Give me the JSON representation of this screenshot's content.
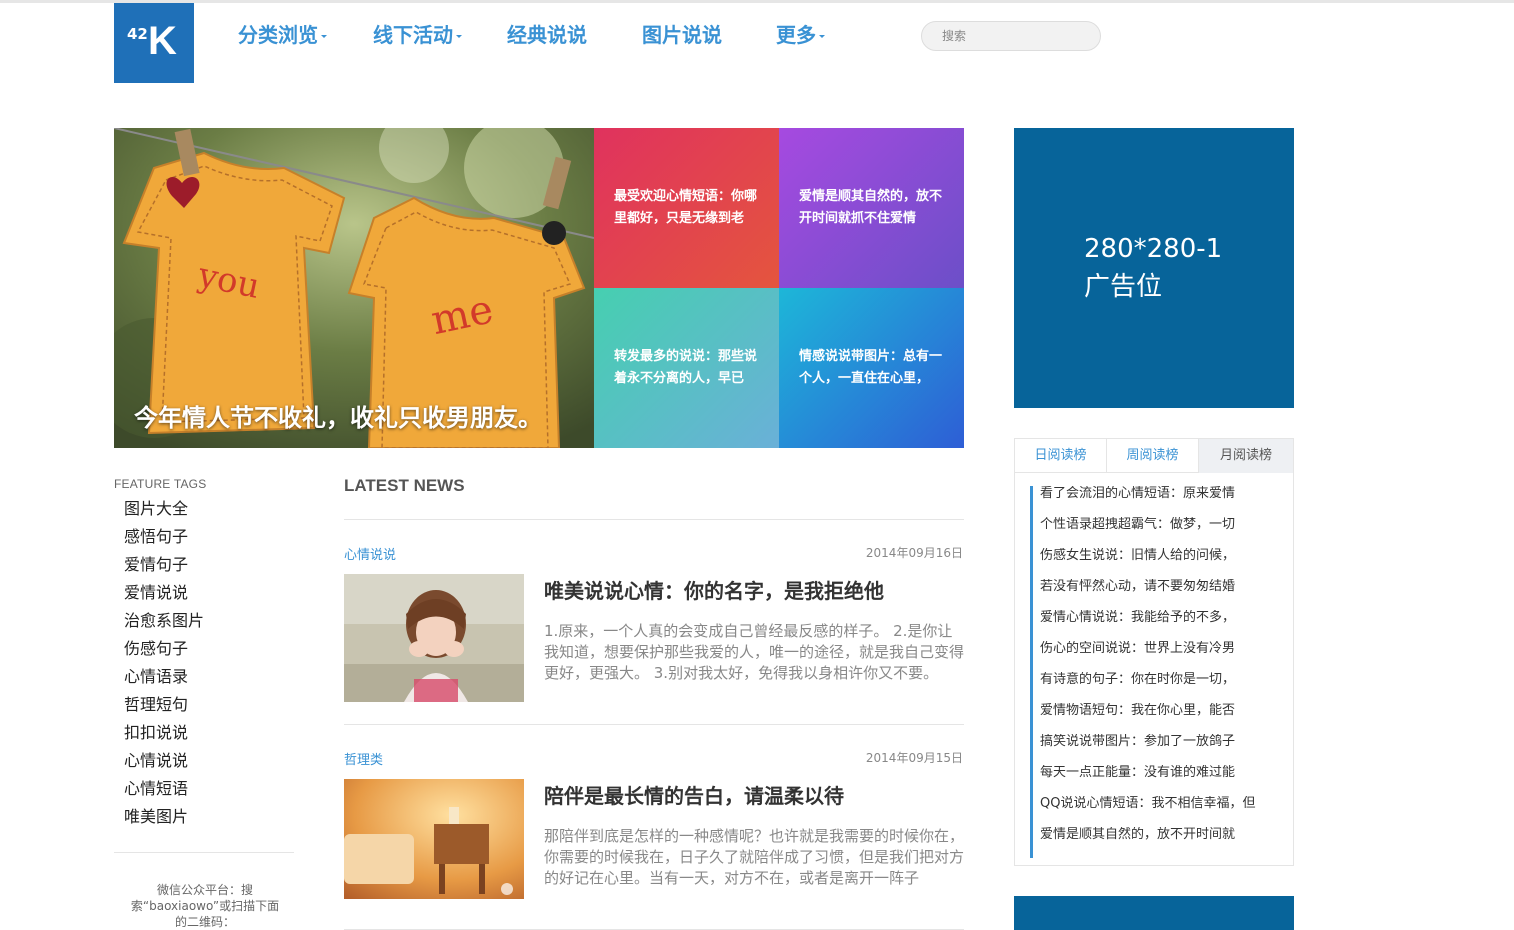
{
  "logo": {
    "num": "42",
    "letter": "K"
  },
  "nav": [
    {
      "label": "分类浏览",
      "dropdown": true
    },
    {
      "label": "线下活动",
      "dropdown": true
    },
    {
      "label": "经典说说",
      "dropdown": false
    },
    {
      "label": "图片说说",
      "dropdown": false
    },
    {
      "label": "更多",
      "dropdown": true
    }
  ],
  "search": {
    "placeholder": "搜索",
    "value": ""
  },
  "hero": {
    "caption": "今年情人节不收礼，收礼只收男朋友。",
    "shirt_left_text": "you",
    "shirt_right_text": "me"
  },
  "tiles": [
    {
      "text": "最受欢迎心情短语：你哪里都好，只是无缘到老"
    },
    {
      "text": "爱情是顺其自然的，放不开时间就抓不住爱情"
    },
    {
      "text": "转发最多的说说：那些说着永不分离的人，早已"
    },
    {
      "text": "情感说说带图片：总有一个人，一直住在心里，"
    }
  ],
  "ad": {
    "top": "280*280-1",
    "bottom": "广告位"
  },
  "rank": {
    "tabs": [
      "日阅读榜",
      "周阅读榜",
      "月阅读榜"
    ],
    "active_tab": 2,
    "items": [
      "看了会流泪的心情短语：原来爱情",
      "个性语录超拽超霸气：做梦，一切",
      "伤感女生说说：旧情人给的问候，",
      "若没有怦然心动，请不要匆匆结婚",
      "爱情心情说说：我能给予的不多，",
      "伤心的空间说说：世界上没有冷男",
      "有诗意的句子：你在时你是一切，",
      "爱情物语短句：我在你心里，能否",
      "搞笑说说带图片：参加了一放鸽子",
      "每天一点正能量：没有谁的难过能",
      "QQ说说心情短语：我不相信幸福，但",
      "爱情是顺其自然的，放不开时间就"
    ]
  },
  "feature_tags": {
    "title": "FEATURE TAGS",
    "items": [
      "图片大全",
      "感悟句子",
      "爱情句子",
      "爱情说说",
      "治愈系图片",
      "伤感句子",
      "心情语录",
      "哲理短句",
      "扣扣说说",
      "心情说说",
      "心情短语",
      "唯美图片"
    ]
  },
  "wechat_text": "微信公众平台：搜索“baoxiaowo”或扫描下面的二维码：",
  "latest_news": {
    "title": "LATEST NEWS",
    "articles": [
      {
        "category": "心情说说",
        "date": "2014年09月16日",
        "title": "唯美说说心情：你的名字，是我拒绝他",
        "excerpt": "1.原来，一个人真的会变成自己曾经最反感的样子。 2.是你让我知道，想要保护那些我爱的人，唯一的途径，就是我自己变得更好，更强大。 3.别对我太好，免得我以身相许你又不要。"
      },
      {
        "category": "哲理类",
        "date": "2014年09月15日",
        "title": "陪伴是最长情的告白，请温柔以待",
        "excerpt": "那陪伴到底是怎样的一种感情呢？也许就是我需要的时候你在，你需要的时候我在，日子久了就陪伴成了习惯，但是我们把对方的好记在心里。当有一天，对方不在，或者是离开一阵子"
      }
    ]
  }
}
